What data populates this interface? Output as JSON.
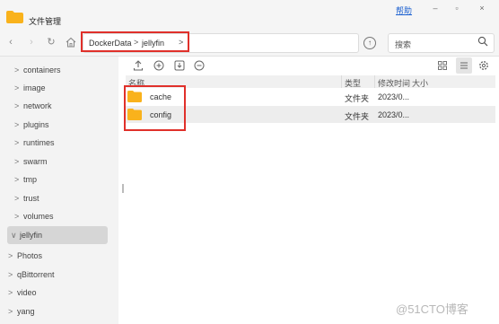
{
  "window": {
    "title": "文件管理",
    "help": "帮助",
    "minimize": "–",
    "maximize": "▫",
    "close": "×"
  },
  "nav": {
    "path": [
      "DockerData",
      "jellyfin"
    ],
    "separator": ">",
    "search_placeholder": "搜索"
  },
  "sidebar": {
    "items": [
      {
        "label": "containers",
        "chevron": ">"
      },
      {
        "label": "image",
        "chevron": ">"
      },
      {
        "label": "network",
        "chevron": ">"
      },
      {
        "label": "plugins",
        "chevron": ">"
      },
      {
        "label": "runtimes",
        "chevron": ">"
      },
      {
        "label": "swarm",
        "chevron": ">"
      },
      {
        "label": "tmp",
        "chevron": ">"
      },
      {
        "label": "trust",
        "chevron": ">"
      },
      {
        "label": "volumes",
        "chevron": ">"
      },
      {
        "label": "jellyfin",
        "chevron": "∨"
      },
      {
        "label": "Photos",
        "chevron": ">"
      },
      {
        "label": "qBittorrent",
        "chevron": ">"
      },
      {
        "label": "video",
        "chevron": ">"
      },
      {
        "label": "yang",
        "chevron": ">"
      }
    ]
  },
  "table": {
    "headers": {
      "name": "名称",
      "type": "类型",
      "modified": "修改时间",
      "size": "大小"
    },
    "rows": [
      {
        "name": "cache",
        "type": "文件夹",
        "modified": "2023/0..."
      },
      {
        "name": "config",
        "type": "文件夹",
        "modified": "2023/0..."
      }
    ]
  },
  "colors": {
    "folder": "#f9b21c",
    "highlight": "#e0302a",
    "link": "#1a5fd0"
  },
  "icons": [
    "folder-icon",
    "back-icon",
    "forward-icon",
    "refresh-icon",
    "home-icon",
    "upload-icon",
    "search-icon",
    "grid-view-icon",
    "list-view-icon",
    "settings-icon"
  ],
  "watermark": "@51CTO博客"
}
